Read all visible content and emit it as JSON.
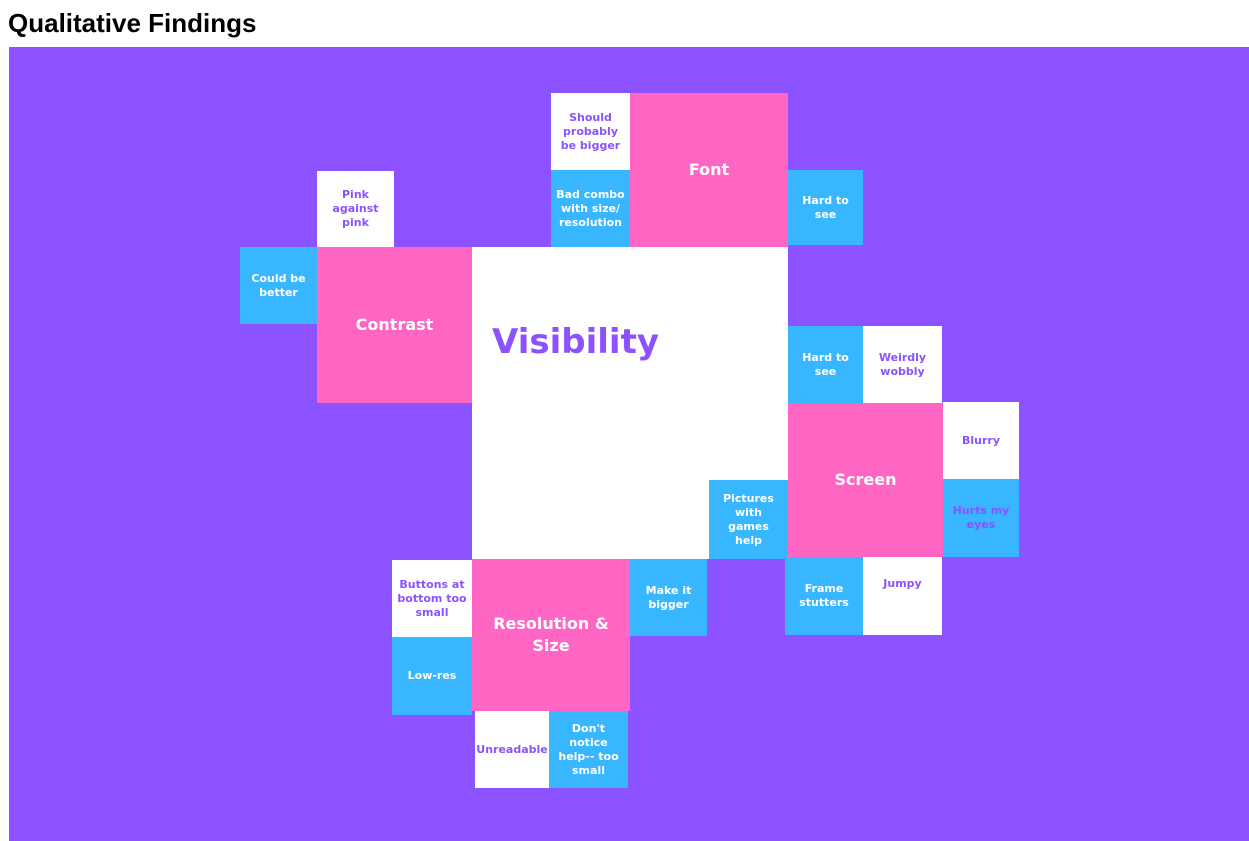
{
  "page": {
    "title": "Qualitative Findings"
  },
  "colors": {
    "background": "#8c52ff",
    "category": "#ff66c4",
    "note_blue": "#38b6ff",
    "note_white": "#ffffff"
  },
  "diagram": {
    "center": "Visibility",
    "clusters": {
      "font": {
        "label": "Font",
        "notes": [
          "Should probably be bigger",
          "Bad combo with size/ resolution",
          "Hard to see"
        ]
      },
      "contrast": {
        "label": "Contrast",
        "notes": [
          "Pink against pink",
          "Could be better"
        ]
      },
      "screen": {
        "label": "Screen",
        "notes": [
          "Hard to see",
          "Weirdly wobbly",
          "Blurry",
          "Hurts my eyes",
          "Pictures with games help",
          "Frame stutters",
          "Jumpy"
        ]
      },
      "resolution": {
        "label": "Resolution & Size",
        "notes": [
          "Buttons at bottom too small",
          "Low-res",
          "Make it bigger",
          "Unreadable",
          "Don't notice help-- too small"
        ]
      }
    }
  }
}
